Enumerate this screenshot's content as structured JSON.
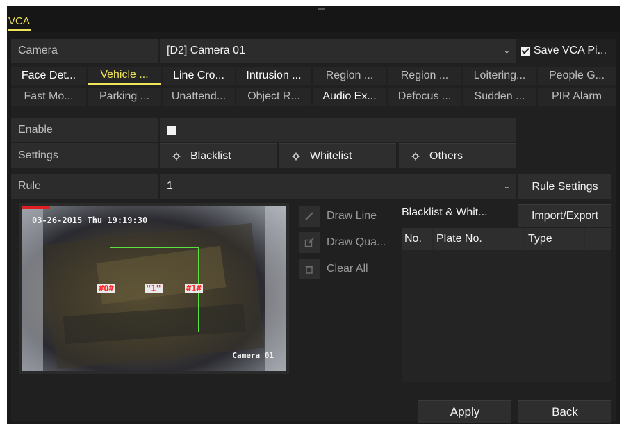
{
  "window": {
    "tab_label": "VCA"
  },
  "camera": {
    "label": "Camera",
    "value": "[D2] Camera 01",
    "save_label": "Save VCA Pi...",
    "save_checked": true
  },
  "vca_tabs_row1": [
    {
      "label": "Face Det...",
      "state": "white"
    },
    {
      "label": "Vehicle ...",
      "state": "active"
    },
    {
      "label": "Line Cro...",
      "state": "white"
    },
    {
      "label": "Intrusion ...",
      "state": "white"
    },
    {
      "label": "Region ...",
      "state": "dim"
    },
    {
      "label": "Region ...",
      "state": "dim"
    },
    {
      "label": "Loitering...",
      "state": "dim"
    },
    {
      "label": "People G...",
      "state": "dim"
    }
  ],
  "vca_tabs_row2": [
    {
      "label": "Fast Mo...",
      "state": "dim"
    },
    {
      "label": "Parking ...",
      "state": "dim"
    },
    {
      "label": "Unattend...",
      "state": "dim"
    },
    {
      "label": "Object R...",
      "state": "dim"
    },
    {
      "label": "Audio Ex...",
      "state": "white"
    },
    {
      "label": "Defocus ...",
      "state": "dim"
    },
    {
      "label": "Sudden ...",
      "state": "dim"
    },
    {
      "label": "PIR Alarm",
      "state": "dim"
    }
  ],
  "enable": {
    "label": "Enable",
    "checked": false
  },
  "settings": {
    "label": "Settings",
    "buttons": [
      "Blacklist",
      "Whitelist",
      "Others"
    ]
  },
  "rule": {
    "label": "Rule",
    "value": "1",
    "settings_button": "Rule Settings"
  },
  "video": {
    "timestamp": "03-26-2015 Thu 19:19:30",
    "camera_label": "Camera 01",
    "tags": [
      "#0#",
      "\"1\"",
      "#1#"
    ]
  },
  "tools": {
    "draw_line": "Draw Line",
    "draw_quad": "Draw Qua...",
    "clear_all": "Clear All"
  },
  "list": {
    "title": "Blacklist & Whit...",
    "import_export": "Import/Export",
    "columns": [
      "No.",
      "Plate No.",
      "Type"
    ]
  },
  "footer": {
    "apply": "Apply",
    "back": "Back"
  },
  "colors": {
    "accent": "#f0e45a",
    "roi": "#5ce23e",
    "tag": "#ff2a2a"
  }
}
